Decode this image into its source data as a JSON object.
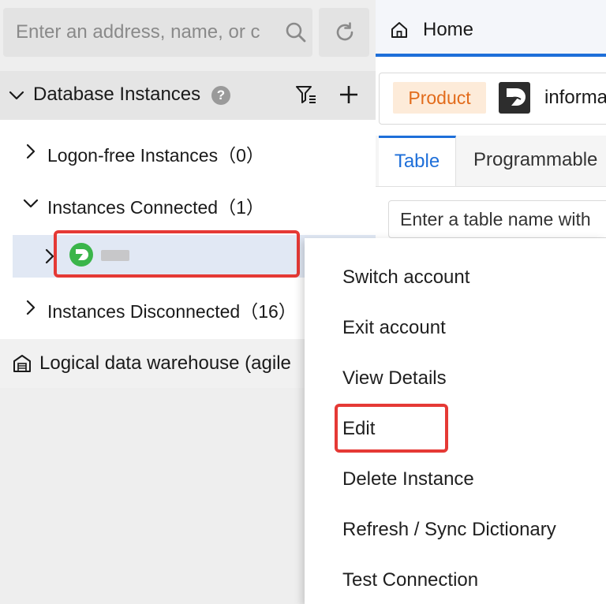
{
  "sidebar": {
    "search": {
      "placeholder": "Enter an address, name, or c",
      "value": ""
    },
    "header": {
      "title": "Database Instances",
      "help": "?"
    },
    "tree": {
      "logon_free": "Logon-free Instances（0）",
      "connected": "Instances Connected（1）",
      "disconnected": "Instances Disconnected（16）"
    },
    "logical_dw": "Logical data warehouse (agile"
  },
  "workspace": {
    "home_tab": "Home",
    "product_tag": "Product",
    "product_name": "informa",
    "tabs": [
      "Table",
      "Programmable"
    ],
    "table_search": {
      "placeholder": "Enter a table name with",
      "value": ""
    }
  },
  "context_menu": {
    "items": [
      "Switch account",
      "Exit account",
      "View Details",
      "Edit",
      "Delete Instance",
      "Refresh / Sync Dictionary",
      "Test Connection"
    ]
  },
  "colors": {
    "accent": "#1e6fd9",
    "highlight_box": "#e53935",
    "selected_row": "#e1e8f4",
    "product_tag_bg": "#fdebd9",
    "product_tag_text": "#e26b1b",
    "instance_logo": "#3bb54a"
  }
}
